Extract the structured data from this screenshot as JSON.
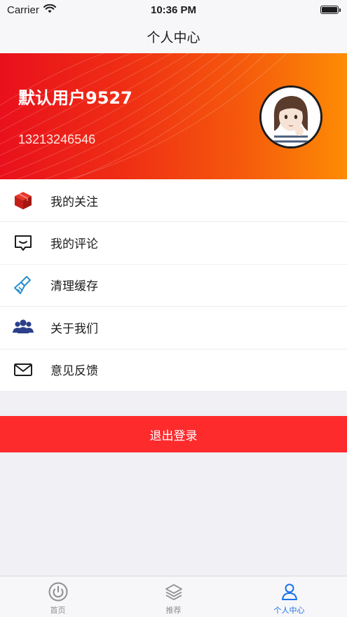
{
  "status_bar": {
    "carrier": "Carrier",
    "time": "10:36 PM"
  },
  "nav": {
    "title": "个人中心"
  },
  "profile": {
    "username": "默认用户9527",
    "phone": "13213246546"
  },
  "menu": {
    "items": [
      {
        "label": "我的关注",
        "icon": "red-box-icon"
      },
      {
        "label": "我的评论",
        "icon": "comment-icon"
      },
      {
        "label": "清理缓存",
        "icon": "brush-icon"
      },
      {
        "label": "关于我们",
        "icon": "people-icon"
      },
      {
        "label": "意见反馈",
        "icon": "mail-icon"
      }
    ]
  },
  "logout": {
    "label": "退出登录"
  },
  "tab_bar": {
    "tabs": [
      {
        "label": "首页",
        "icon": "home-power-icon"
      },
      {
        "label": "推荐",
        "icon": "layers-icon"
      },
      {
        "label": "个人中心",
        "icon": "person-icon"
      }
    ],
    "active_index": 2
  },
  "colors": {
    "header_gradient_start": "#e9101c",
    "header_gradient_end": "#fd8c04",
    "logout_bg": "#fe2b2d",
    "tab_active": "#1a73e8"
  }
}
